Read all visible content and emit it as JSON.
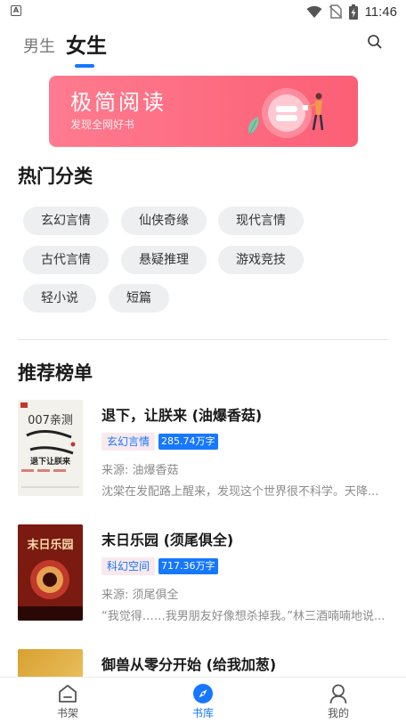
{
  "status_bar": {
    "time": "11:46",
    "app_icon_letter": "A"
  },
  "header": {
    "tabs": [
      {
        "label": "男生",
        "active": false
      },
      {
        "label": "女生",
        "active": true
      }
    ],
    "accent_color": "#1677ff"
  },
  "banner": {
    "title": "极简阅读",
    "subtitle": "发现全网好书"
  },
  "hot_categories": {
    "title": "热门分类",
    "tags": [
      "玄幻言情",
      "仙侠奇缘",
      "现代言情",
      "古代言情",
      "悬疑推理",
      "游戏竞技",
      "轻小说",
      "短篇"
    ]
  },
  "recommend": {
    "title": "推荐榜单",
    "books": [
      {
        "title": "退下，让朕来 (油爆香菇)",
        "category": "玄幻言情",
        "words": "285.74万字",
        "source": "来源: 油爆香菇",
        "desc": "沈棠在发配路上醒来，发现这个世界很不科学。天降...",
        "cover_top": "007亲测",
        "cover_main": "退下让朕来"
      },
      {
        "title": "末日乐园 (须尾俱全)",
        "category": "科幻空间",
        "words": "717.36万字",
        "source": "来源: 须尾俱全",
        "desc": "“我觉得……我男朋友好像想杀掉我。”林三酒喃喃地说...",
        "cover_main": "末日乐园"
      },
      {
        "title": "御兽从零分开始 (给我加葱)"
      }
    ]
  },
  "tab_bar": {
    "items": [
      {
        "label": "书架",
        "icon": "bookshelf-icon",
        "active": false
      },
      {
        "label": "书库",
        "icon": "compass-icon",
        "active": true
      },
      {
        "label": "我的",
        "icon": "user-icon",
        "active": false
      }
    ]
  }
}
